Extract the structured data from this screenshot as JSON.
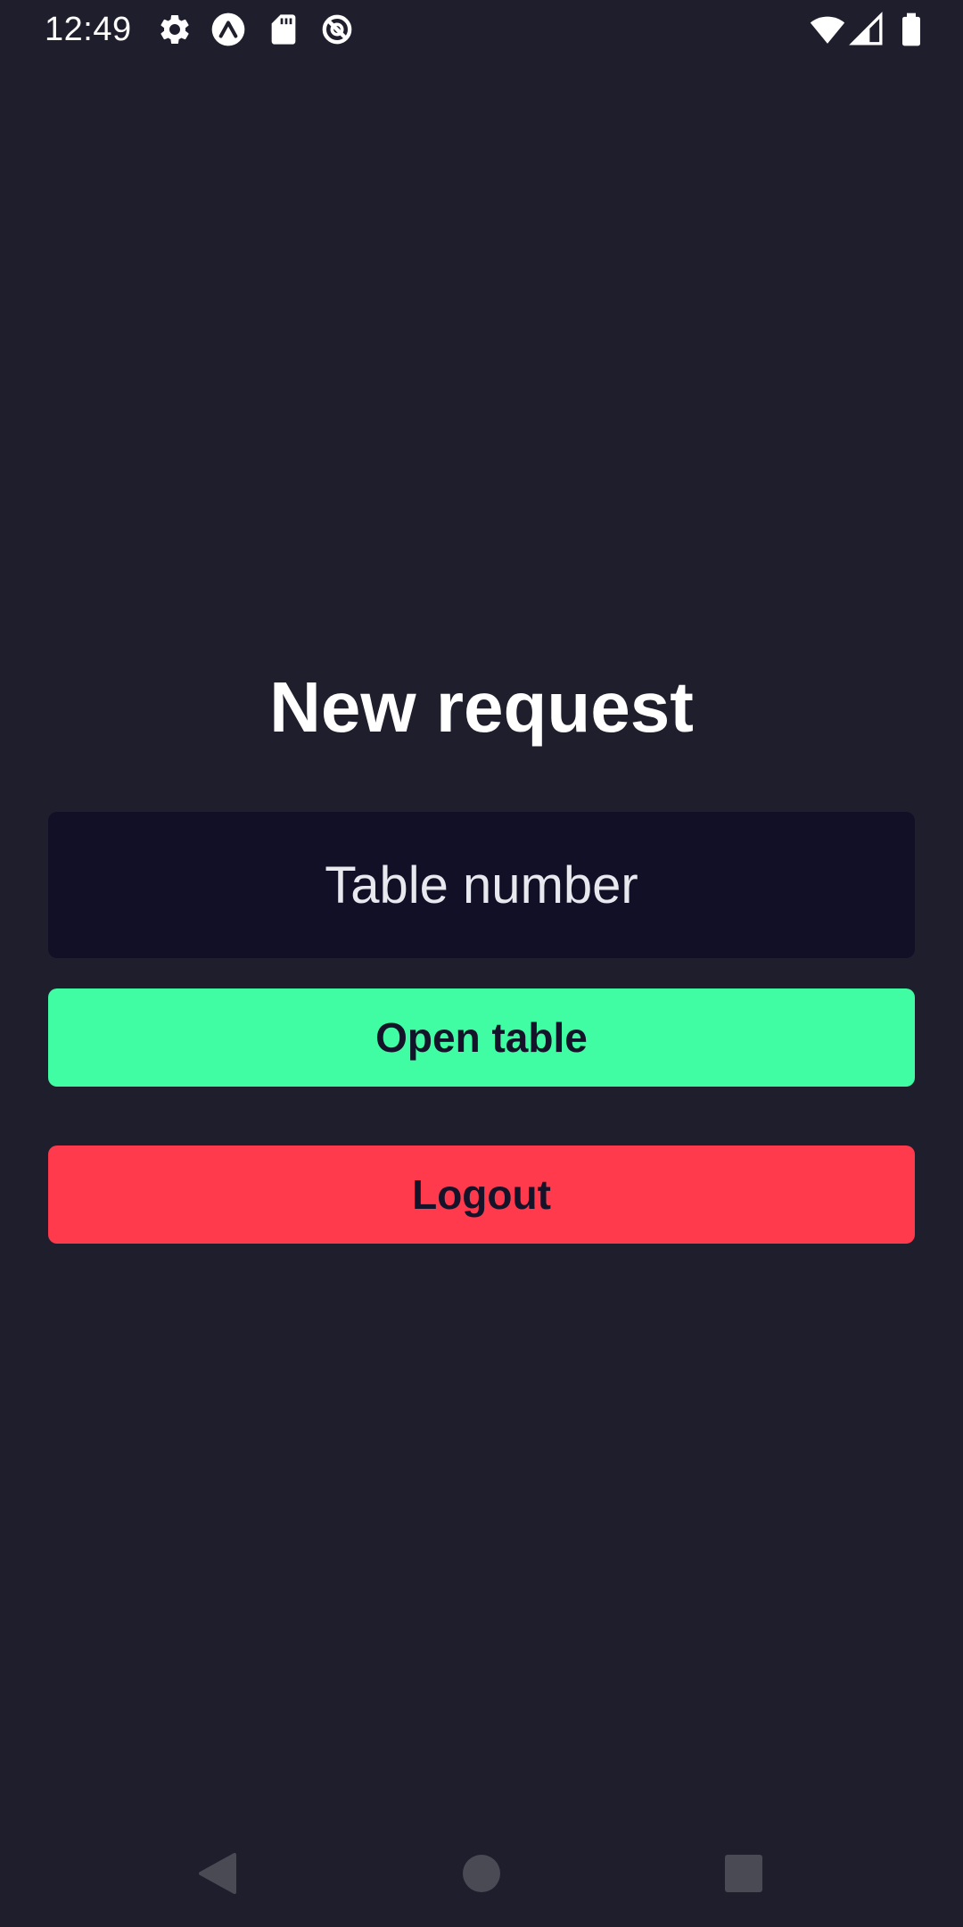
{
  "status_bar": {
    "time": "12:49",
    "left_icons": [
      "gear-icon",
      "expo-icon",
      "sd-card-icon",
      "no-sync-icon"
    ],
    "right_icons": [
      "wifi-icon",
      "cellular-signal-icon",
      "battery-icon"
    ]
  },
  "screen": {
    "title": "New request",
    "table_input": {
      "placeholder": "Table number",
      "value": ""
    },
    "open_button_label": "Open table",
    "logout_button_label": "Logout"
  },
  "nav_bar": {
    "icons": [
      "back-icon",
      "home-icon",
      "recents-icon"
    ]
  },
  "colors": {
    "background": "#1f1e2d",
    "input_background": "#111027",
    "open_button": "#40fca3",
    "logout_button": "#fe3a4c",
    "button_text": "#14132a",
    "nav_icon": "#4a4a55"
  }
}
